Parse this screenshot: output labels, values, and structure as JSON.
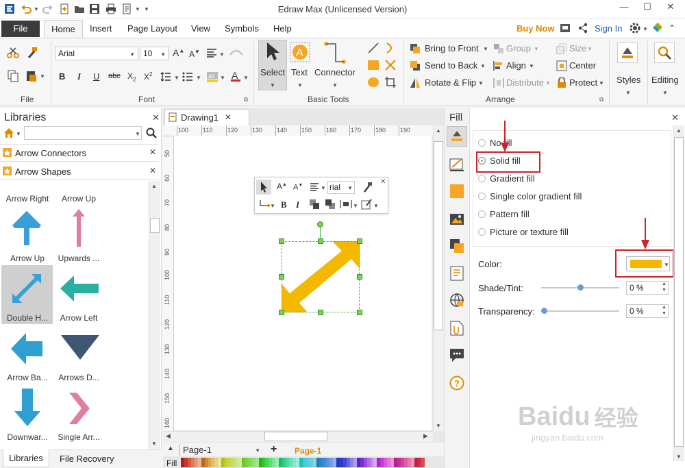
{
  "window": {
    "title": "Edraw Max (Unlicensed Version)"
  },
  "menu": {
    "file": "File",
    "tabs": [
      "Home",
      "Insert",
      "Page Layout",
      "View",
      "Symbols",
      "Help"
    ],
    "buy_now": "Buy Now",
    "sign_in": "Sign In"
  },
  "ribbon": {
    "groups": {
      "file": "File",
      "font": "Font",
      "basic_tools": "Basic Tools",
      "arrange": "Arrange"
    },
    "font_name": "Arial",
    "font_size": "10",
    "tools": {
      "select": "Select",
      "text": "Text",
      "connector": "Connector"
    },
    "arrange": {
      "bring_to_front": "Bring to Front",
      "send_to_back": "Send to Back",
      "rotate_flip": "Rotate & Flip",
      "group": "Group",
      "align": "Align",
      "distribute": "Distribute",
      "size": "Size",
      "center": "Center",
      "protect": "Protect"
    },
    "styles": "Styles",
    "editing": "Editing"
  },
  "libraries": {
    "title": "Libraries",
    "search_placeholder": "",
    "sections": [
      "Arrow Connectors",
      "Arrow Shapes"
    ],
    "top_labels": [
      "Arrow Right",
      "Arrow Up"
    ],
    "shapes": [
      "Arrow Up",
      "Upwards ...",
      "Double H...",
      "Arrow Left",
      "Arrow Ba...",
      "Arrows D...",
      "Downwar...",
      "Single Arr..."
    ],
    "bottom_tabs": [
      "Libraries",
      "File Recovery"
    ]
  },
  "document": {
    "tab": "Drawing1",
    "ruler_h": [
      "100",
      "110",
      "120",
      "130",
      "140",
      "150",
      "160",
      "170",
      "180",
      "190"
    ],
    "ruler_v": [
      "50",
      "60",
      "70",
      "80",
      "90",
      "100",
      "110",
      "120",
      "130",
      "140",
      "150",
      "160"
    ],
    "mini_toolbar_font": "rial",
    "page_tabs": [
      "Page-1",
      "Page-1"
    ],
    "fill_label": "Fill"
  },
  "fill_panel": {
    "title": "Fill",
    "options": [
      "No fill",
      "Solid fill",
      "Gradient fill",
      "Single color gradient fill",
      "Pattern fill",
      "Picture or texture fill"
    ],
    "selected": "Solid fill",
    "color_label": "Color:",
    "color_value": "#f5b800",
    "shade_label": "Shade/Tint:",
    "shade_value": "0 %",
    "shade_level": 0.5,
    "transparency_label": "Transparency:",
    "transparency_value": "0 %",
    "transparency_level": 0
  },
  "watermark": {
    "brand": "Baidu",
    "chinese": "经验",
    "url": "jingyan.baidu.com"
  },
  "colors": {
    "accent": "#f5b800",
    "arrow_blue": "#3a9fd8",
    "highlight": "#d0202a",
    "pink": "#e07ea0",
    "teal": "#2ab0a0",
    "navy": "#3e5673"
  }
}
